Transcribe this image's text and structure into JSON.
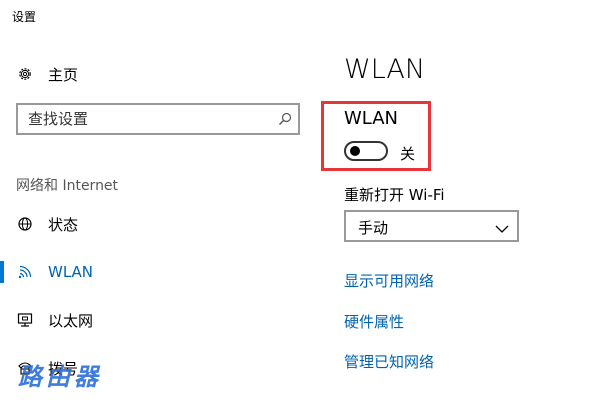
{
  "window": {
    "title": "设置"
  },
  "sidebar": {
    "home_label": "主页",
    "search": {
      "placeholder": "查找设置",
      "value": ""
    },
    "section_heading": "网络和 Internet",
    "items": [
      {
        "label": "状态",
        "icon": "globe-icon",
        "active": false
      },
      {
        "label": "WLAN",
        "icon": "wifi-icon",
        "active": true
      },
      {
        "label": "以太网",
        "icon": "ethernet-icon",
        "active": false
      },
      {
        "label": "拨号",
        "icon": "dialup-icon",
        "active": false
      }
    ]
  },
  "main": {
    "title": "WLAN",
    "wifi_toggle": {
      "label": "WLAN",
      "state_text": "关",
      "on": false
    },
    "reconnect": {
      "label": "重新打开 Wi-Fi",
      "selected": "手动"
    },
    "links": [
      "显示可用网络",
      "硬件属性",
      "管理已知网络"
    ]
  },
  "colors": {
    "accent": "#0078d7",
    "link": "#0063b1",
    "highlight": "#e8353a",
    "watermark": "#2a6fdb"
  },
  "watermark": {
    "text": "路由器"
  }
}
